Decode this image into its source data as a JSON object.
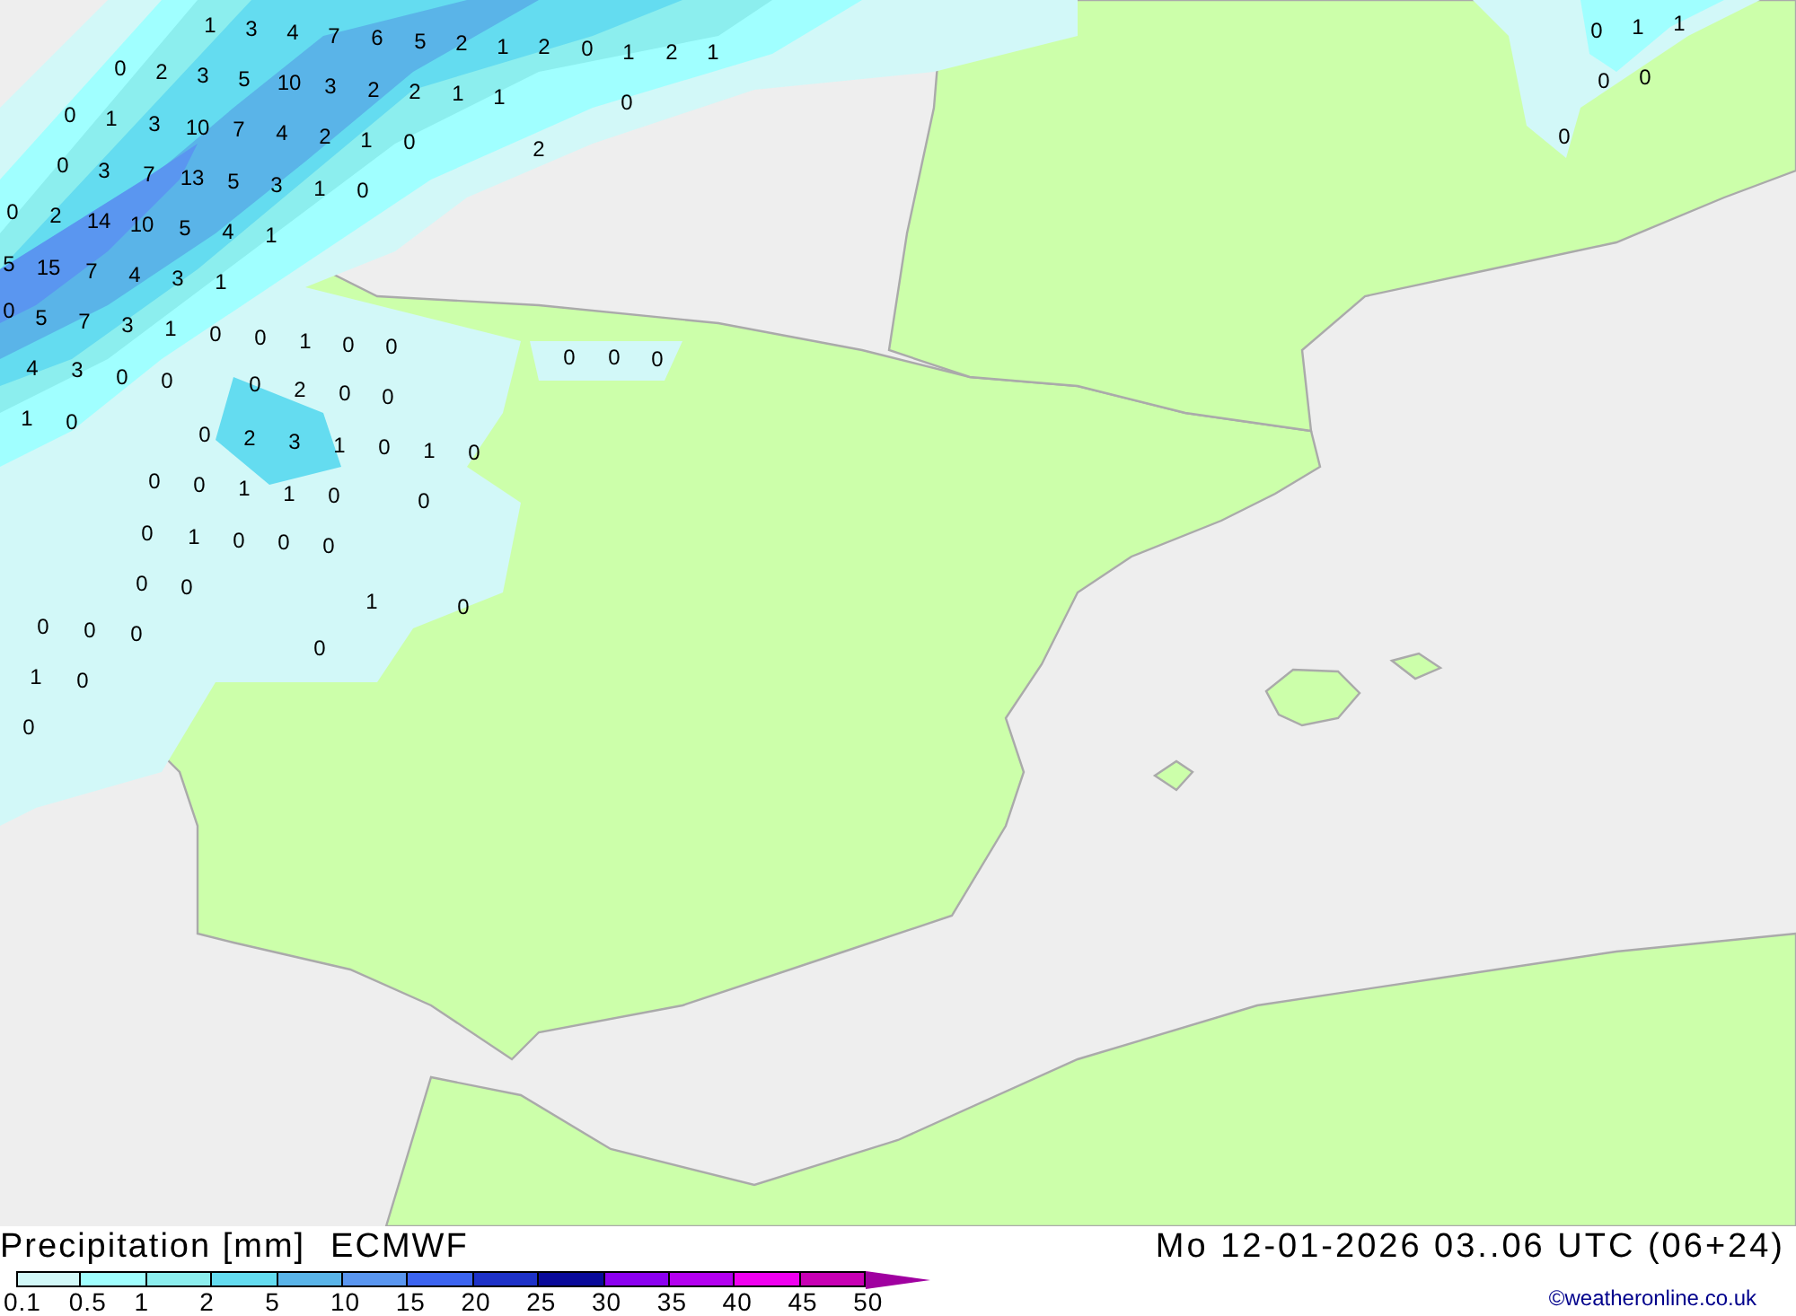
{
  "map": {
    "values": [
      "1",
      "3",
      "4",
      "7",
      "6",
      "5",
      "2",
      "1",
      "2",
      "0",
      "1",
      "2",
      "1",
      "0",
      "2",
      "3",
      "5",
      "10",
      "3",
      "2",
      "2",
      "1",
      "1",
      "0",
      "0",
      "1",
      "3",
      "10",
      "7",
      "4",
      "2",
      "1",
      "0",
      "2",
      "0",
      "3",
      "7",
      "13",
      "5",
      "3",
      "1",
      "0",
      "0",
      "2",
      "14",
      "10",
      "5",
      "4",
      "1",
      "5",
      "15",
      "7",
      "4",
      "3",
      "1",
      "0",
      "5",
      "7",
      "3",
      "1",
      "0",
      "0",
      "1",
      "0",
      "0",
      "0",
      "0",
      "0",
      "4",
      "3",
      "0",
      "0",
      "0",
      "2",
      "0",
      "0",
      "1",
      "0",
      "0",
      "2",
      "3",
      "1",
      "0",
      "1",
      "0",
      "0",
      "0",
      "1",
      "1",
      "0",
      "0",
      "0",
      "1",
      "0",
      "0",
      "0",
      "0",
      "0",
      "1",
      "0",
      "0",
      "0",
      "0",
      "0",
      "1",
      "0",
      "0",
      "0",
      "1",
      "1",
      "0",
      "0",
      "0"
    ]
  },
  "footer": {
    "title": "Precipitation [mm]",
    "model": "ECMWF",
    "valid_time": "Mo 12-01-2026 03..06 UTC (06+24)",
    "credit": "©weatheronline.co.uk"
  },
  "legend": {
    "bins": [
      {
        "color": "#d2f8f8"
      },
      {
        "color": "#a0ffff"
      },
      {
        "color": "#8ceeee"
      },
      {
        "color": "#64dcf0"
      },
      {
        "color": "#5ab4e8"
      },
      {
        "color": "#5a96f0"
      },
      {
        "color": "#3c64f0"
      },
      {
        "color": "#1e32c8"
      },
      {
        "color": "#0a0a9a"
      },
      {
        "color": "#8c00f0"
      },
      {
        "color": "#b400f0"
      },
      {
        "color": "#f000f0"
      },
      {
        "color": "#c800b4"
      }
    ],
    "labels": [
      "0.1",
      "0.5",
      "1",
      "2",
      "5",
      "10",
      "15",
      "20",
      "25",
      "30",
      "35",
      "40",
      "45",
      "50"
    ]
  }
}
